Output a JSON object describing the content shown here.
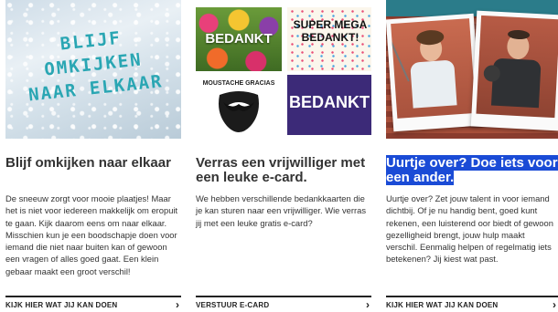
{
  "cards": [
    {
      "image_text": "BLIJF OMKIJKEN NAAR ELKAAR",
      "title": "Blijf omkijken naar elkaar",
      "description": "De sneeuw zorgt voor mooie plaatjes! Maar het is niet voor iedereen makkelijk om eropuit te gaan. Kijk daarom eens om naar elkaar. Misschien kun je een boodschapje doen voor iemand die niet naar buiten kan of gewoon een vragen of alles goed gaat. Een klein gebaar maakt een groot verschil!",
      "cta": "KIJK HIER WAT JIJ KAN DOEN"
    },
    {
      "tiles": {
        "t1": "BEDANKT",
        "t2": "SUPER MEGA BEDANKT!",
        "t3": "MOUSTACHE GRACIAS",
        "t4": "BEDANKT"
      },
      "title": "Verras een vrijwilliger met een leuke e-card.",
      "description": "We hebben verschillende bedankkaarten die je kan sturen naar een vrijwilliger. Wie verras jij met een leuke gratis e-card?",
      "cta": "VERSTUUR E-CARD"
    },
    {
      "title": "Uurtje over? Doe iets voor een ander.",
      "description": "Uurtje over? Zet jouw talent in voor iemand dichtbij. Of je nu handig bent, goed kunt rekenen, een luisterend oor biedt of gewoon gezelligheid brengt, jouw hulp maakt verschil. Eenmalig helpen of regelmatig iets betekenen? Jij kiest wat past.",
      "cta": "KIJK HIER WAT JIJ KAN DOEN"
    }
  ],
  "icons": {
    "cta_arrow": "chevron-right-icon"
  },
  "colors": {
    "accent_teal": "#2aa6b3",
    "highlight_blue": "#1a4bd6",
    "ecard_purple": "#3c2a78"
  }
}
